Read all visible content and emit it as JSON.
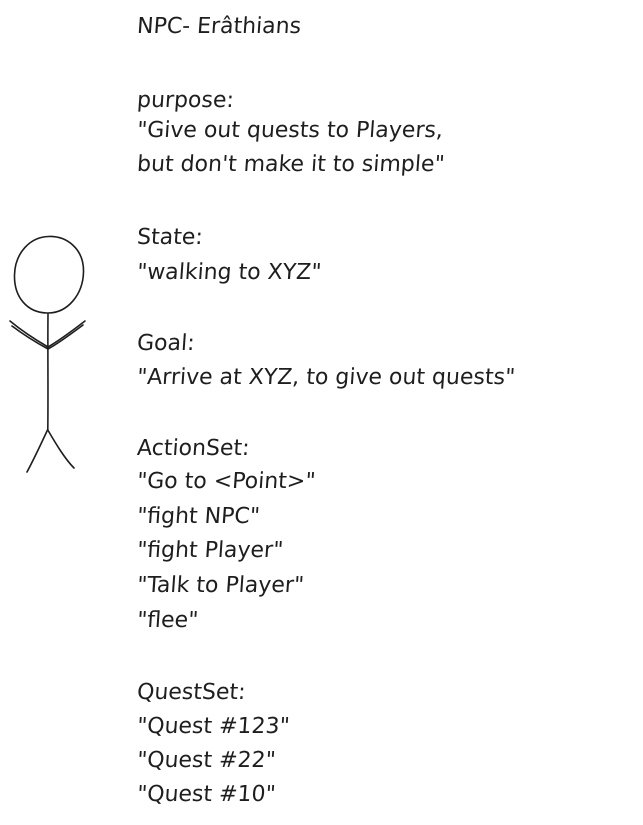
{
  "title": "NPC- Erâthians",
  "sections": [
    {
      "heading": "purpose:",
      "lines": [
        "\"Give out quests to Players,",
        "but don't make it to simple\""
      ]
    },
    {
      "heading": "State:",
      "lines": [
        "\"walking to XYZ\""
      ]
    },
    {
      "heading": "Goal:",
      "lines": [
        "\"Arrive at XYZ, to give out quests\""
      ]
    },
    {
      "heading": "ActionSet:",
      "lines": [
        "\"Go to <Point>\"",
        "\"fight NPC\"",
        "\"fight Player\"",
        "\"Talk to Player\"",
        "\"flee\""
      ]
    },
    {
      "heading": "QuestSet:",
      "lines": [
        "\"Quest #123\"",
        "\"Quest #22\"",
        "\"Quest #10\""
      ]
    }
  ],
  "colors": {
    "ink": "#1e1e1e",
    "background": "#ffffff"
  },
  "icons": {
    "figure": "stick-figure-icon"
  }
}
